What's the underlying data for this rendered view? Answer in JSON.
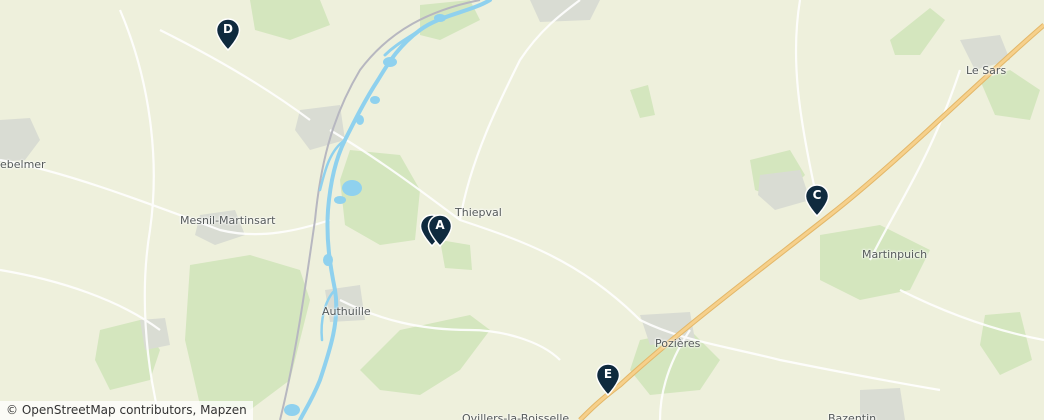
{
  "map": {
    "places": [
      {
        "id": "beaumont-hamel-partial",
        "label": "ebelmer"
      },
      {
        "id": "mesnil-martinsart",
        "label": "Mesnil-Martinsart"
      },
      {
        "id": "thiepval",
        "label": "Thiepval"
      },
      {
        "id": "authuille",
        "label": "Authuille"
      },
      {
        "id": "le-sars",
        "label": "Le Sars"
      },
      {
        "id": "martinpuich",
        "label": "Martinpuich"
      },
      {
        "id": "pozieres",
        "label": "Pozières"
      },
      {
        "id": "ovillers",
        "label": "Ovillers-la-Boisselle"
      },
      {
        "id": "bazentin",
        "label": "Bazentin"
      }
    ],
    "markers": [
      {
        "id": "marker-a",
        "label": "A"
      },
      {
        "id": "marker-b",
        "label": ""
      },
      {
        "id": "marker-c",
        "label": "C"
      },
      {
        "id": "marker-d",
        "label": "D"
      },
      {
        "id": "marker-e",
        "label": "E"
      }
    ],
    "marker_color": "#0f2a3e",
    "river_color": "#8fd1ee",
    "road_color": "#f0c77a",
    "land_color": "#eef0dc",
    "wood_color": "#d4e6be"
  },
  "attribution": {
    "copyright": "© OpenStreetMap contributors, Mapzen"
  }
}
